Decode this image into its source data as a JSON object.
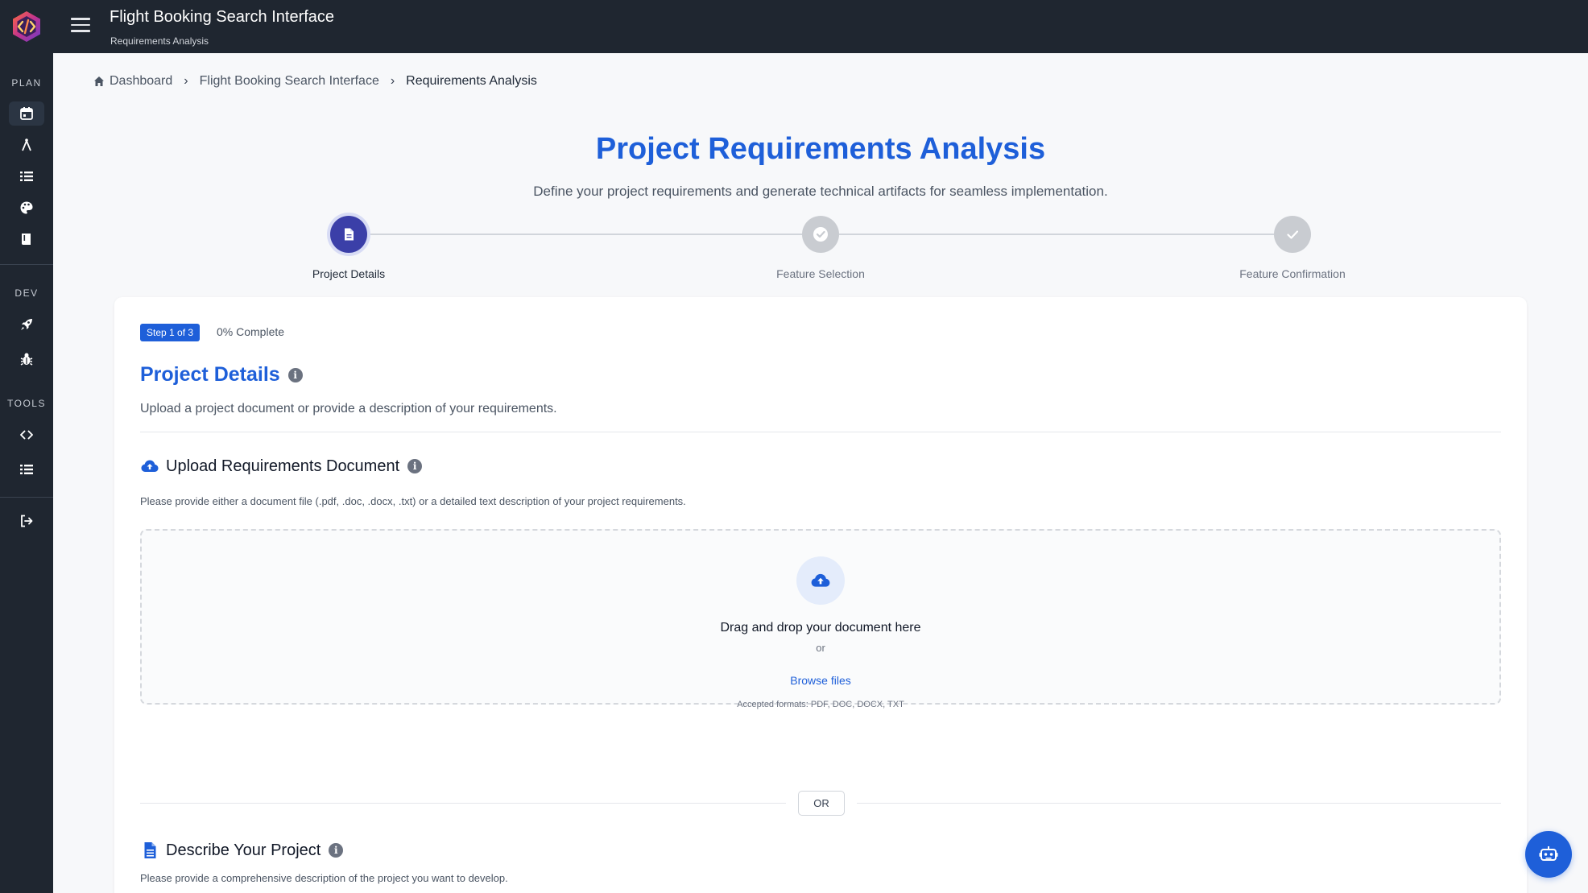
{
  "header": {
    "title": "Flight Booking Search Interface",
    "subtitle": "Requirements Analysis"
  },
  "sidebar": {
    "sections": [
      {
        "label": "PLAN",
        "items": [
          "calendar-icon",
          "compass-icon",
          "list-icon",
          "palette-icon",
          "book-icon"
        ]
      },
      {
        "label": "DEV",
        "items": [
          "rocket-icon",
          "bug-icon"
        ]
      },
      {
        "label": "TOOLS",
        "items": [
          "code-icon",
          "list-icon"
        ]
      }
    ],
    "footer_item": "logout-icon"
  },
  "breadcrumb": {
    "items": [
      "Dashboard",
      "Flight Booking Search Interface",
      "Requirements Analysis"
    ]
  },
  "hero": {
    "title": "Project Requirements Analysis",
    "subtitle": "Define your project requirements and generate technical artifacts for seamless implementation."
  },
  "stepper": {
    "steps": [
      {
        "label": "Project Details",
        "state": "active"
      },
      {
        "label": "Feature Selection",
        "state": "pending"
      },
      {
        "label": "Feature Confirmation",
        "state": "pending"
      }
    ]
  },
  "card": {
    "step_badge": "Step 1 of 3",
    "progress_text": "0% Complete",
    "section_title": "Project Details",
    "section_desc": "Upload a project document or provide a description of your requirements.",
    "upload": {
      "title": "Upload Requirements Document",
      "desc": "Please provide either a document file (.pdf, .doc, .docx, .txt) or a detailed text description of your project requirements.",
      "drop_title": "Drag and drop your document here",
      "drop_or": "or",
      "browse_label": "Browse files",
      "formats": "Accepted formats: PDF, DOC, DOCX, TXT"
    },
    "or_divider": "OR",
    "describe": {
      "title": "Describe Your Project",
      "desc": "Please provide a comprehensive description of the project you want to develop."
    }
  },
  "colors": {
    "accent": "#1e5fd9",
    "sidebar_bg": "#1f2630",
    "step_active": "#3b3fa8",
    "step_pending": "#c9ccd1"
  }
}
